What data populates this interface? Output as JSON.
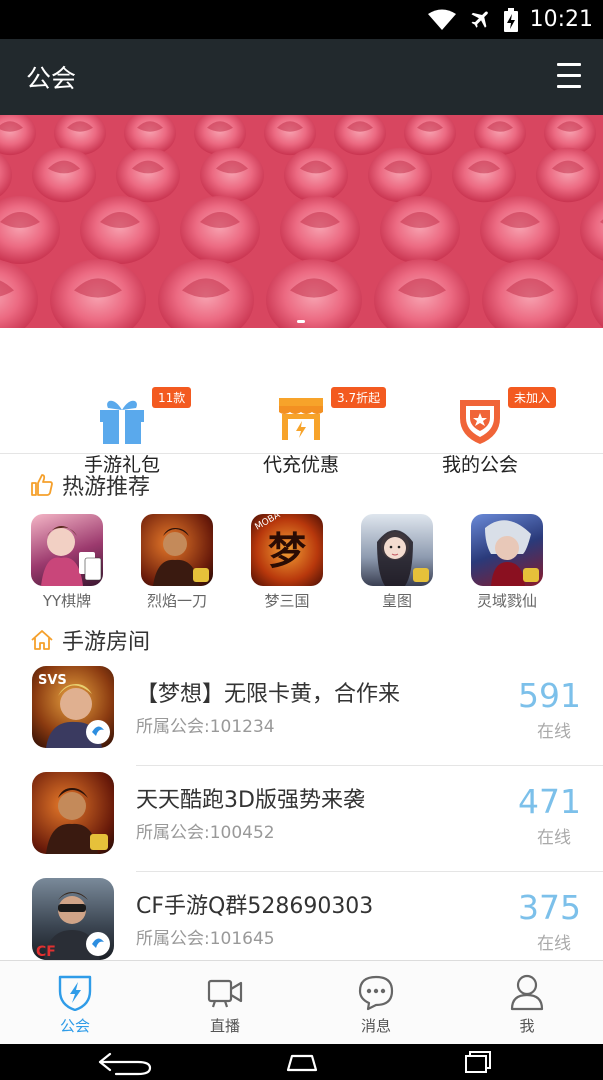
{
  "status_bar": {
    "time": "10:21",
    "icons": [
      "wifi-icon",
      "airplane-icon",
      "battery-charging-icon"
    ]
  },
  "header": {
    "title": "公会",
    "menu_icon": "hamburger-menu-icon"
  },
  "banner": {
    "page_indicator": {
      "current": 1
    }
  },
  "quick_actions": [
    {
      "label": "手游礼包",
      "badge": "11款",
      "icon": "gift-icon"
    },
    {
      "label": "代充优惠",
      "badge": "3.7折起",
      "icon": "shop-icon"
    },
    {
      "label": "我的公会",
      "badge": "未加入",
      "icon": "shield-star-icon"
    }
  ],
  "hot_games": {
    "title": "热游推荐",
    "icon": "thumbs-up-icon",
    "items": [
      {
        "name": "YY棋牌"
      },
      {
        "name": "烈焰一刀"
      },
      {
        "name": "梦三国"
      },
      {
        "name": "皇图"
      },
      {
        "name": "灵域戮仙"
      }
    ]
  },
  "rooms": {
    "title": "手游房间",
    "icon": "home-icon",
    "items": [
      {
        "title": "【梦想】无限卡黄，合作来",
        "guild": "所属公会:101234",
        "count": "591",
        "online": "在线"
      },
      {
        "title": "天天酷跑3D版强势来袭",
        "guild": "所属公会:100452",
        "count": "471",
        "online": "在线"
      },
      {
        "title": "CF手游Q群528690303",
        "guild": "所属公会:101645",
        "count": "375",
        "online": "在线"
      }
    ]
  },
  "bottom_nav": [
    {
      "label": "公会",
      "icon": "guild-shield-icon",
      "active": true
    },
    {
      "label": "直播",
      "icon": "video-camera-icon",
      "active": false
    },
    {
      "label": "消息",
      "icon": "chat-bubble-icon",
      "active": false
    },
    {
      "label": "我",
      "icon": "person-icon",
      "active": false
    }
  ],
  "colors": {
    "accent": "#2f9ce8",
    "badge": "#f35a20",
    "header_bg": "#22292d",
    "count": "#7cc0ea"
  }
}
